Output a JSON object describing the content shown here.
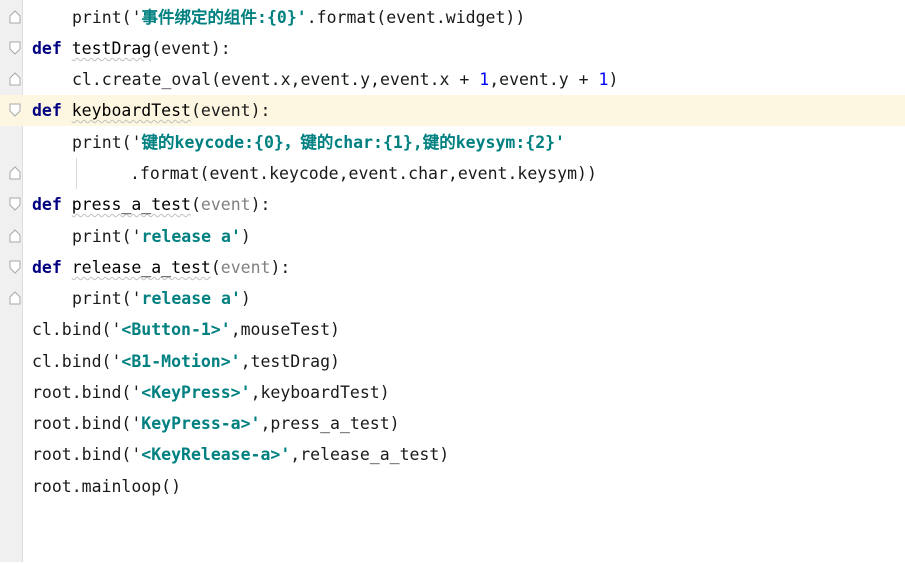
{
  "editor": {
    "lines": [
      {
        "id": "l1",
        "parts": [
          {
            "t": "print('",
            "c": ""
          },
          {
            "t": "事件绑定的组件:{0}'",
            "c": "str"
          },
          {
            "t": ".format(event.widget))",
            "c": ""
          }
        ]
      },
      {
        "id": "l2",
        "parts": [
          {
            "t": "def",
            "c": "kw"
          },
          {
            "t": " ",
            "c": ""
          },
          {
            "t": "testDrag",
            "c": "fname"
          },
          {
            "t": "(event):",
            "c": ""
          }
        ]
      },
      {
        "id": "l3",
        "parts": [
          {
            "t": "cl.create_oval(event.x,event.y,event.x + ",
            "c": ""
          },
          {
            "t": "1",
            "c": "num"
          },
          {
            "t": ",event.y + ",
            "c": ""
          },
          {
            "t": "1",
            "c": "num"
          },
          {
            "t": ")",
            "c": ""
          }
        ]
      },
      {
        "id": "l4",
        "parts": [
          {
            "t": "def",
            "c": "kw"
          },
          {
            "t": " ",
            "c": ""
          },
          {
            "t": "keyboardTest",
            "c": "fname"
          },
          {
            "t": "(event):",
            "c": ""
          }
        ]
      },
      {
        "id": "l5",
        "parts": [
          {
            "t": "print('",
            "c": ""
          },
          {
            "t": "键的keycode:{0}，键的char:{1},键的keysym:{2}'",
            "c": "str"
          }
        ]
      },
      {
        "id": "l6",
        "parts": [
          {
            "t": ".format(event.keycode,event.char,event.keysym))",
            "c": ""
          }
        ]
      },
      {
        "id": "l7",
        "parts": [
          {
            "t": "def",
            "c": "kw"
          },
          {
            "t": " ",
            "c": ""
          },
          {
            "t": "press_a_test",
            "c": "fname"
          },
          {
            "t": "(",
            "c": ""
          },
          {
            "t": "event",
            "c": "param"
          },
          {
            "t": "):",
            "c": ""
          }
        ]
      },
      {
        "id": "l8",
        "parts": [
          {
            "t": "print('",
            "c": ""
          },
          {
            "t": "release a'",
            "c": "str"
          },
          {
            "t": ")",
            "c": ""
          }
        ]
      },
      {
        "id": "l9",
        "parts": [
          {
            "t": "def",
            "c": "kw"
          },
          {
            "t": " ",
            "c": ""
          },
          {
            "t": "release_a_test",
            "c": "fname"
          },
          {
            "t": "(",
            "c": ""
          },
          {
            "t": "event",
            "c": "param"
          },
          {
            "t": "):",
            "c": ""
          }
        ]
      },
      {
        "id": "l10",
        "parts": [
          {
            "t": "print('",
            "c": ""
          },
          {
            "t": "release a'",
            "c": "str"
          },
          {
            "t": ")",
            "c": ""
          }
        ]
      },
      {
        "id": "l11",
        "parts": [
          {
            "t": "cl.bind('",
            "c": ""
          },
          {
            "t": "<Button-1>'",
            "c": "str"
          },
          {
            "t": ",mouseTest)",
            "c": ""
          }
        ]
      },
      {
        "id": "l12",
        "parts": [
          {
            "t": "cl.bind('",
            "c": ""
          },
          {
            "t": "<B1-Motion>'",
            "c": "str"
          },
          {
            "t": ",testDrag)",
            "c": ""
          }
        ]
      },
      {
        "id": "l13",
        "parts": [
          {
            "t": "root.bind('",
            "c": ""
          },
          {
            "t": "<KeyPress>'",
            "c": "str"
          },
          {
            "t": ",keyboardTest)",
            "c": ""
          }
        ]
      },
      {
        "id": "l14",
        "parts": [
          {
            "t": "root.bind('",
            "c": ""
          },
          {
            "t": "KeyPress-a>'",
            "c": "str"
          },
          {
            "t": ",press_a_test)",
            "c": ""
          }
        ]
      },
      {
        "id": "l15",
        "parts": [
          {
            "t": "root.bind('",
            "c": ""
          },
          {
            "t": "<KeyRelease-a>'",
            "c": "str"
          },
          {
            "t": ",release_a_test)",
            "c": ""
          }
        ]
      },
      {
        "id": "l16",
        "parts": [
          {
            "t": "root.mainloop()",
            "c": ""
          }
        ]
      }
    ]
  },
  "icons": {
    "bulb": "lightbulb-icon",
    "fold": "fold-marker-icon"
  },
  "colors": {
    "keyword": "#000080",
    "string": "#008080",
    "number": "#0000ff",
    "param_unused": "#808080",
    "current_line": "#fdf7e1",
    "bulb": "#f4a61c"
  }
}
